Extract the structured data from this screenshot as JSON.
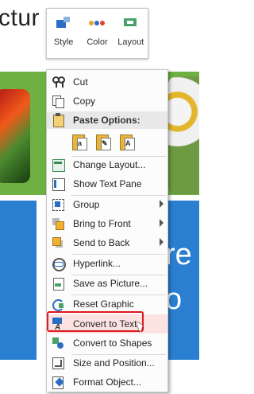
{
  "slide": {
    "title_fragment": "ctur",
    "right_text_line1": "re",
    "right_text_line2": "o"
  },
  "mini_toolbar": {
    "buttons": [
      {
        "label": "Style",
        "icon": "style-icon"
      },
      {
        "label": "Color",
        "icon": "color-icon"
      },
      {
        "label": "Layout",
        "icon": "layout-icon"
      }
    ],
    "color_dots": [
      "#f0a030",
      "#2b6cc4",
      "#e0452a",
      "#4aa26a"
    ]
  },
  "menu": {
    "cut": {
      "label": "Cut",
      "accel": "t"
    },
    "copy": {
      "label": "Copy",
      "accel": "C"
    },
    "paste_header": "Paste Options:",
    "paste_options": [
      "a",
      "✎",
      "A"
    ],
    "change_layout": "Change Layout...",
    "show_text_pane": "Show Text Pane",
    "group": "Group",
    "bring_to_front": "Bring to Front",
    "send_to_back": "Send to Back",
    "hyperlink": "Hyperlink...",
    "save_as_picture": "Save as Picture...",
    "reset_graphic": "Reset Graphic",
    "convert_to_text": "Convert to Text",
    "convert_to_shapes": "Convert to Shapes",
    "size_and_position": "Size and Position...",
    "format_object": "Format Object..."
  },
  "highlight_color": "#e0191f"
}
